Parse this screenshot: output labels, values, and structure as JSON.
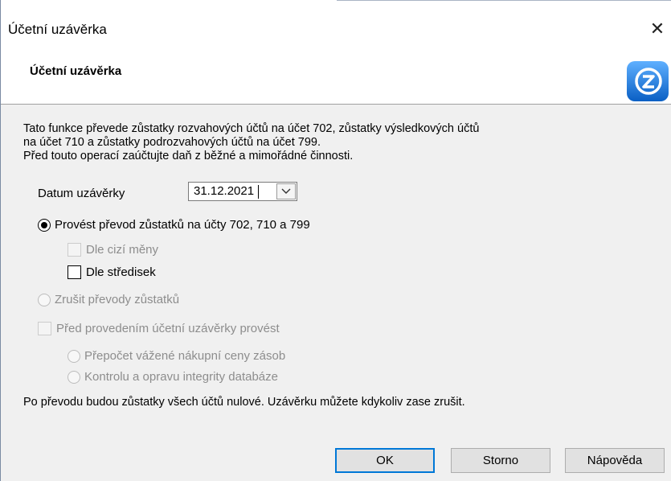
{
  "window": {
    "title": "Účetní uzávěrka",
    "close_glyph": "✕"
  },
  "header": {
    "title": "Účetní uzávěrka",
    "icon": "app-logo-icon",
    "icon_color": "#1a7fe0"
  },
  "intro": {
    "line1": "Tato funkce převede zůstatky rozvahových účtů na účet 702, zůstatky výsledkových účtů",
    "line2": "na účet 710 a zůstatky podrozvahových účtů na účet 799.",
    "line3": "Před touto operací zaúčtujte daň z běžné a mimořádné činnosti."
  },
  "date": {
    "label": "Datum uzávěrky",
    "value": "31.12.2021"
  },
  "options": {
    "transfer": {
      "label": "Provést převod zůstatků na účty 702, 710 a 799",
      "checked": true
    },
    "foreign_currency": {
      "label": "Dle cizí měny",
      "checked": false,
      "disabled": true
    },
    "by_centers": {
      "label": "Dle středisek",
      "checked": false,
      "disabled": false
    },
    "cancel_transfers": {
      "label": "Zrušit převody zůstatků",
      "checked": false,
      "disabled": true
    },
    "before_closing": {
      "label": "Před provedením účetní uzávěrky provést",
      "checked": false,
      "disabled": true
    },
    "recalc_price": {
      "label": "Přepočet vážené nákupní ceny zásob",
      "disabled": true
    },
    "integrity_check": {
      "label": "Kontrolu a opravu integrity databáze",
      "disabled": true
    }
  },
  "footer": {
    "note": "Po převodu budou zůstatky všech účtů nulové. Uzávěrku můžete kdykoliv zase zrušit."
  },
  "buttons": {
    "ok": "OK",
    "cancel": "Storno",
    "help": "Nápověda"
  }
}
